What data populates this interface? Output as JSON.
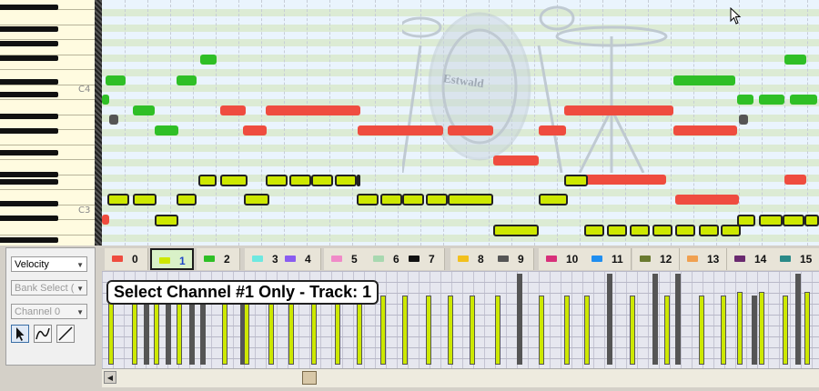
{
  "piano": {
    "labels": [
      "C4",
      "C3"
    ]
  },
  "tracks": [
    {
      "num": "0",
      "color": "#ef4c3f"
    },
    {
      "num": "1",
      "color": "#cde800",
      "active": true
    },
    {
      "num": "2",
      "color": "#2fbf26"
    },
    {
      "num": "3",
      "color": "#6ee8e0"
    },
    {
      "num": "4",
      "color": "#8a5cf0"
    },
    {
      "num": "5",
      "color": "#f08ac8"
    },
    {
      "num": "6",
      "color": "#a8d8b0"
    },
    {
      "num": "7",
      "color": "#111111"
    },
    {
      "num": "8",
      "color": "#f2c01c"
    },
    {
      "num": "9",
      "color": "#555555"
    },
    {
      "num": "10",
      "color": "#d8307a"
    },
    {
      "num": "11",
      "color": "#1f8ef0"
    },
    {
      "num": "12",
      "color": "#6a7a30"
    },
    {
      "num": "13",
      "color": "#f0a050"
    },
    {
      "num": "14",
      "color": "#6a2a70"
    },
    {
      "num": "15",
      "color": "#2a8a88"
    }
  ],
  "left_panel": {
    "controller": "Velocity",
    "bank": "Bank Select (",
    "channel": "Channel 0"
  },
  "tooltip": "Select Channel #1 Only - Track: 1",
  "drum_logo": "Estwald",
  "icons": [
    "pointer-tool-icon",
    "curve-tool-icon",
    "line-tool-icon",
    "scroll-left-icon",
    "mouse-cursor-icon"
  ]
}
